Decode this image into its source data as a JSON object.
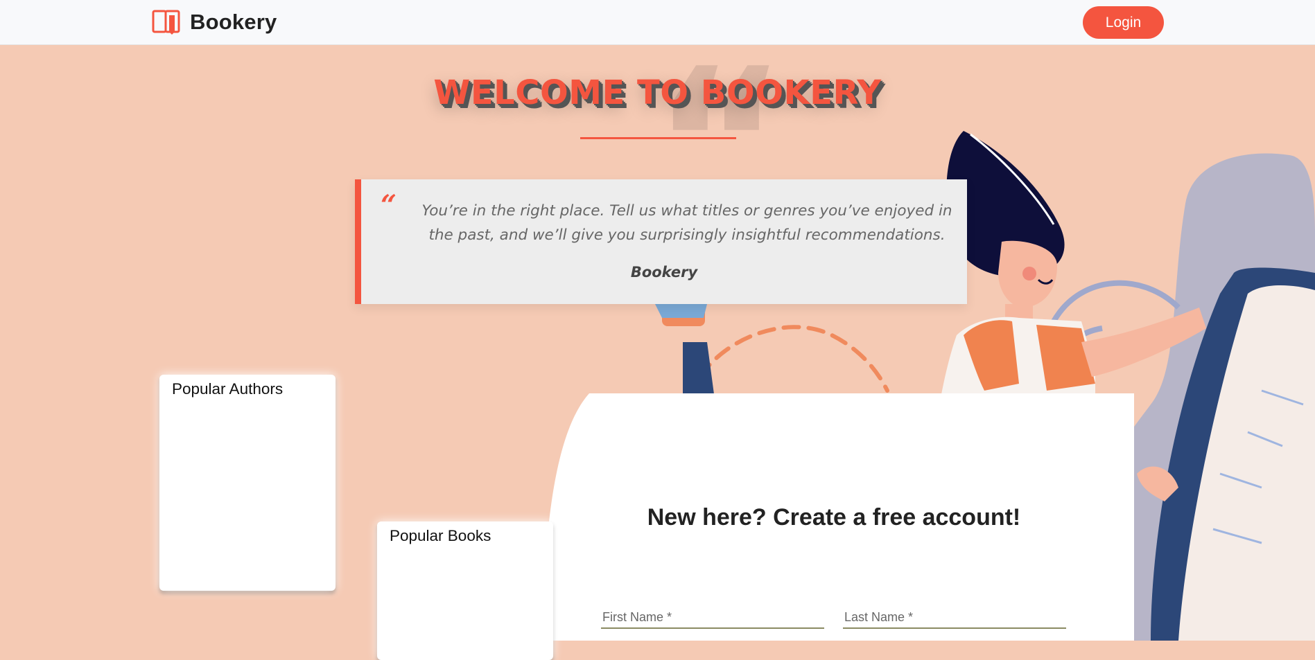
{
  "navbar": {
    "brand_name": "Bookery",
    "login_label": "Login",
    "icon": "book-logo-icon"
  },
  "hero": {
    "title": "WELCOME TO BOOKERY",
    "quote_mark": "“",
    "big_quote_mark": "“",
    "quote_text": "You’re in the right place. Tell us what titles or genres you’ve enjoyed in the past, and we’ll give you surprisingly insightful recommendations.",
    "quote_author": "Bookery"
  },
  "sidebar": {
    "popular_authors_title": "Popular Authors",
    "popular_books_title": "Popular Books"
  },
  "signup": {
    "title": "New here? Create a free account!",
    "first_name_placeholder": "First Name *",
    "last_name_placeholder": "Last Name *"
  },
  "colors": {
    "accent": "#f4553f",
    "background": "#f5cab4",
    "navbar_bg": "#f8f9fb",
    "quote_bg": "#ededed",
    "navy": "#2c4778"
  }
}
